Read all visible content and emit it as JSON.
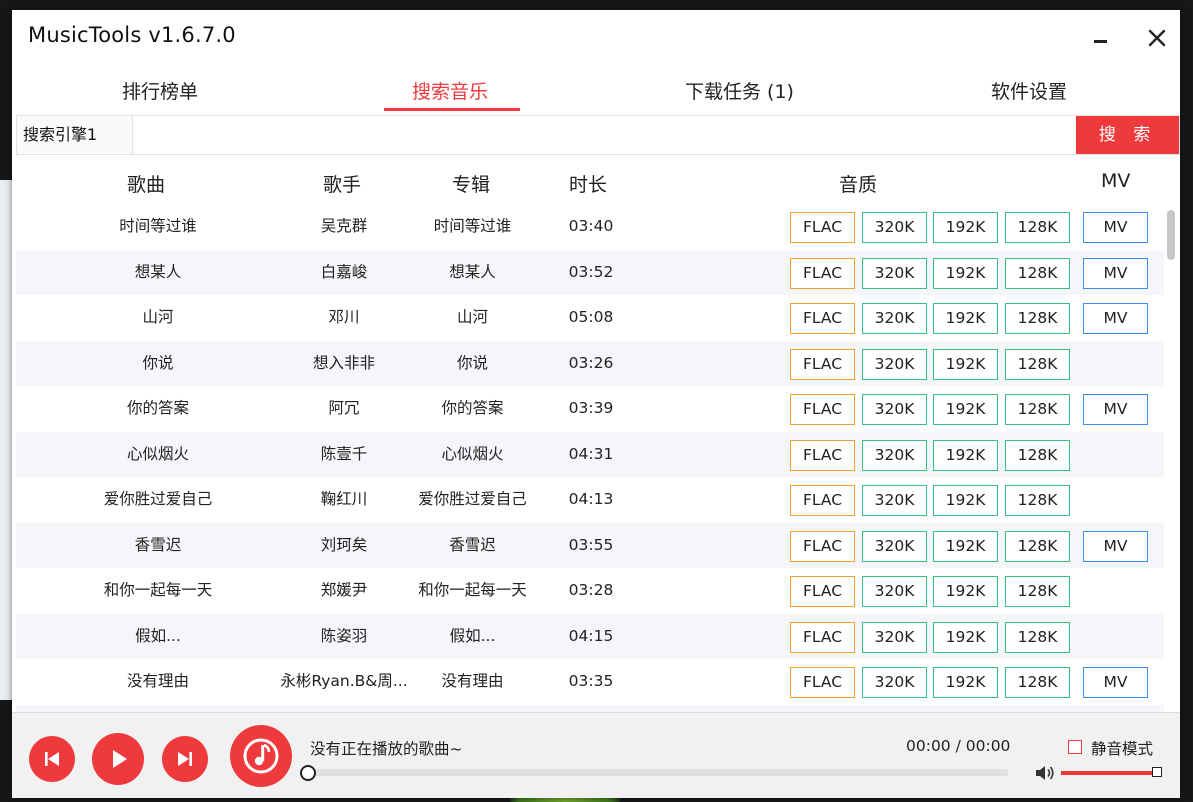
{
  "window": {
    "title": "MusicTools v1.6.7.0"
  },
  "tabs": [
    {
      "label": "排行榜单",
      "active": false
    },
    {
      "label": "搜索音乐",
      "active": true
    },
    {
      "label": "下载任务 (1)",
      "active": false
    },
    {
      "label": "软件设置",
      "active": false
    }
  ],
  "search": {
    "engine": "搜索引擎1",
    "query": "",
    "button": "搜 索"
  },
  "columns": {
    "song": "歌曲",
    "artist": "歌手",
    "album": "专辑",
    "duration": "时长",
    "quality": "音质",
    "mv": "MV"
  },
  "quality_labels": {
    "flac": "FLAC",
    "k320": "320K",
    "k192": "192K",
    "k128": "128K",
    "mv": "MV"
  },
  "rows": [
    {
      "song": "时间等过谁",
      "artist": "吴克群",
      "album": "时间等过谁",
      "duration": "03:40",
      "mv": true
    },
    {
      "song": "想某人",
      "artist": "白嘉峻",
      "album": "想某人",
      "duration": "03:52",
      "mv": true
    },
    {
      "song": "山河",
      "artist": "邓川",
      "album": "山河",
      "duration": "05:08",
      "mv": true
    },
    {
      "song": "你说",
      "artist": "想入非非",
      "album": "你说",
      "duration": "03:26",
      "mv": false
    },
    {
      "song": "你的答案",
      "artist": "阿冗",
      "album": "你的答案",
      "duration": "03:39",
      "mv": true
    },
    {
      "song": "心似烟火",
      "artist": "陈壹千",
      "album": "心似烟火",
      "duration": "04:31",
      "mv": false
    },
    {
      "song": "爱你胜过爱自己",
      "artist": "鞠红川",
      "album": "爱你胜过爱自己",
      "duration": "04:13",
      "mv": false
    },
    {
      "song": "香雪迟",
      "artist": "刘珂矣",
      "album": "香雪迟",
      "duration": "03:55",
      "mv": true
    },
    {
      "song": "和你一起每一天",
      "artist": "郑媛尹",
      "album": "和你一起每一天",
      "duration": "03:28",
      "mv": false
    },
    {
      "song": "假如...",
      "artist": "陈姿羽",
      "album": "假如...",
      "duration": "04:15",
      "mv": false
    },
    {
      "song": "没有理由",
      "artist": "永彬Ryan.B&周...",
      "album": "没有理由",
      "duration": "03:35",
      "mv": true
    },
    {
      "song": "",
      "artist": "",
      "album": "",
      "duration": "",
      "mv": false
    }
  ],
  "player": {
    "now_playing": "没有正在播放的歌曲~",
    "time": "00:00 / 00:00",
    "mute_label": "静音模式",
    "mute": false,
    "progress": 0,
    "volume": 1.0
  },
  "colors": {
    "accent": "#ef3a3d",
    "flac_border": "#f0a22e",
    "bitrate_border": "#38c080",
    "mv_border": "#3e8ff0"
  },
  "icons": [
    "minimize-icon",
    "close-icon",
    "previous-icon",
    "play-icon",
    "next-icon",
    "music-note-icon",
    "volume-icon"
  ]
}
